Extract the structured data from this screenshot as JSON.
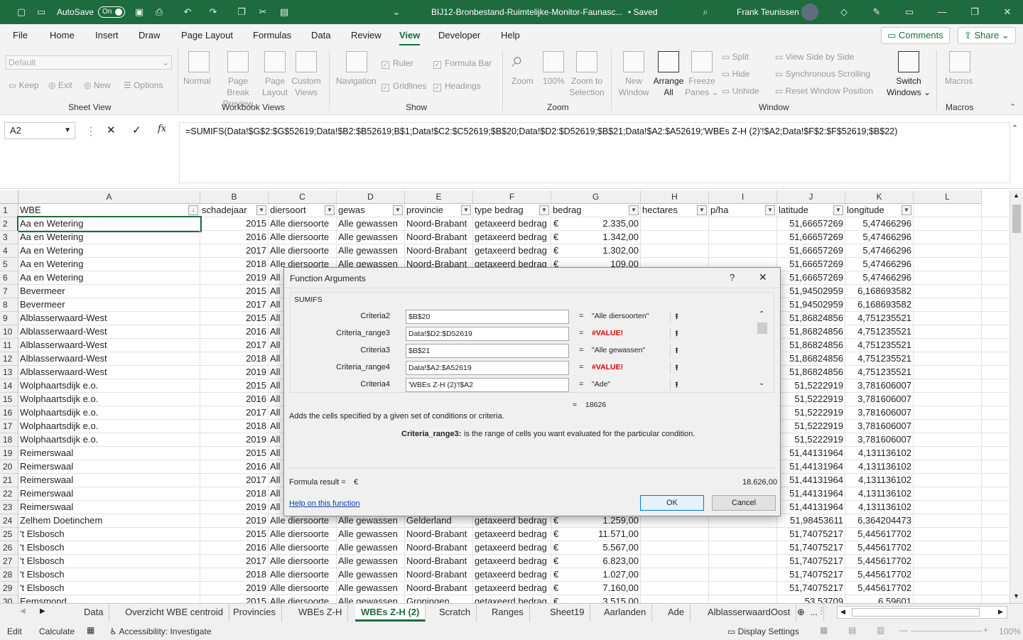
{
  "titlebar": {
    "autosave_label": "AutoSave",
    "autosave_state": "On",
    "filename": "BIJ12-Bronbestand-Ruimtelijke-Monitor-Faunasc...",
    "saved": "• Saved",
    "user": "Frank Teunissen"
  },
  "tabs": [
    "File",
    "Home",
    "Insert",
    "Draw",
    "Page Layout",
    "Formulas",
    "Data",
    "Review",
    "View",
    "Developer",
    "Help"
  ],
  "active_tab": "View",
  "topright": {
    "comments": "Comments",
    "share": "Share"
  },
  "ribbon": {
    "sheetview": {
      "default": "Default",
      "keep": "Keep",
      "exit": "Exit",
      "new": "New",
      "options": "Options",
      "label": "Sheet View"
    },
    "workbookviews": {
      "normal": "Normal",
      "pagebreak1": "Page Break",
      "pagebreak2": "Preview",
      "pagelayout1": "Page",
      "pagelayout2": "Layout",
      "custom1": "Custom",
      "custom2": "Views",
      "label": "Workbook Views"
    },
    "show": {
      "navigation": "Navigation",
      "ruler": "Ruler",
      "formulabar": "Formula Bar",
      "gridlines": "Gridlines",
      "headings": "Headings",
      "label": "Show"
    },
    "zoom": {
      "zoom": "Zoom",
      "hundred": "100%",
      "zts1": "Zoom to",
      "zts2": "Selection",
      "label": "Zoom"
    },
    "window": {
      "new1": "New",
      "new2": "Window",
      "arrange1": "Arrange",
      "arrange2": "All",
      "freeze1": "Freeze",
      "freeze2": "Panes",
      "split": "Split",
      "hide": "Hide",
      "unhide": "Unhide",
      "sbs": "View Side by Side",
      "sync": "Synchronous Scrolling",
      "reset": "Reset Window Position",
      "switch1": "Switch",
      "switch2": "Windows",
      "label": "Window"
    },
    "macros": {
      "macros": "Macros",
      "label": "Macros"
    }
  },
  "namebox": "A2",
  "formula": "=SUMIFS(Data!$G$2:$G$52619;Data!$B2:$B52619;B$1;Data!$C2:$C52619;$B$20;Data!$D2:$D52619;$B$21;Data!$A2:$A52619;'WBEs Z-H (2)'!$A2;Data!$F$2:$F$52619;$B$22)",
  "columns": [
    "A",
    "B",
    "C",
    "D",
    "E",
    "F",
    "G",
    "H",
    "I",
    "J",
    "K",
    "L"
  ],
  "headers": [
    "WBE",
    "schadejaar",
    "diersoort",
    "gewas",
    "provincie",
    "type bedrag",
    "bedrag",
    "hectares",
    "p/ha",
    "latitude",
    "longitude"
  ],
  "rows": [
    {
      "n": "2",
      "a": "Aa en Wetering",
      "b": "2015",
      "c": "Alle diersoorte",
      "d": "Alle gewassen",
      "e": "Noord-Brabant",
      "f": "getaxeerd bedrag",
      "g": "2.335,00",
      "j": "51,66657269",
      "k": "5,47466296"
    },
    {
      "n": "3",
      "a": "Aa en Wetering",
      "b": "2016",
      "c": "Alle diersoorte",
      "d": "Alle gewassen",
      "e": "Noord-Brabant",
      "f": "getaxeerd bedrag",
      "g": "1.342,00",
      "j": "51,66657269",
      "k": "5,47466296"
    },
    {
      "n": "4",
      "a": "Aa en Wetering",
      "b": "2017",
      "c": "Alle diersoorte",
      "d": "Alle gewassen",
      "e": "Noord-Brabant",
      "f": "getaxeerd bedrag",
      "g": "1.302,00",
      "j": "51,66657269",
      "k": "5,47466296"
    },
    {
      "n": "5",
      "a": "Aa en Wetering",
      "b": "2018",
      "c": "Alle diersoorte",
      "d": "Alle gewassen",
      "e": "Noord-Brabant",
      "f": "getaxeerd bedrag",
      "g": "109,00",
      "j": "51,66657269",
      "k": "5,47466296"
    },
    {
      "n": "6",
      "a": "Aa en Wetering",
      "b": "2019",
      "c": "All",
      "d": "",
      "e": "",
      "f": "",
      "g": "",
      "j": "51,66657269",
      "k": "5,47466296"
    },
    {
      "n": "7",
      "a": "Bevermeer",
      "b": "2015",
      "c": "All",
      "d": "",
      "e": "",
      "f": "",
      "g": "",
      "j": "51,94502959",
      "k": "6,168693582"
    },
    {
      "n": "8",
      "a": "Bevermeer",
      "b": "2017",
      "c": "All",
      "d": "",
      "e": "",
      "f": "",
      "g": "",
      "j": "51,94502959",
      "k": "6,168693582"
    },
    {
      "n": "9",
      "a": "Alblasserwaard-West",
      "b": "2015",
      "c": "All",
      "d": "",
      "e": "",
      "f": "",
      "g": "",
      "j": "51,86824856",
      "k": "4,751235521"
    },
    {
      "n": "10",
      "a": "Alblasserwaard-West",
      "b": "2016",
      "c": "All",
      "d": "",
      "e": "",
      "f": "",
      "g": "",
      "j": "51,86824856",
      "k": "4,751235521"
    },
    {
      "n": "11",
      "a": "Alblasserwaard-West",
      "b": "2017",
      "c": "All",
      "d": "",
      "e": "",
      "f": "",
      "g": "",
      "j": "51,86824856",
      "k": "4,751235521"
    },
    {
      "n": "12",
      "a": "Alblasserwaard-West",
      "b": "2018",
      "c": "All",
      "d": "",
      "e": "",
      "f": "",
      "g": "",
      "j": "51,86824856",
      "k": "4,751235521"
    },
    {
      "n": "13",
      "a": "Alblasserwaard-West",
      "b": "2019",
      "c": "All",
      "d": "",
      "e": "",
      "f": "",
      "g": "",
      "j": "51,86824856",
      "k": "4,751235521"
    },
    {
      "n": "14",
      "a": "Wolphaartsdijk e.o.",
      "b": "2015",
      "c": "All",
      "d": "",
      "e": "",
      "f": "",
      "g": "",
      "j": "51,5222919",
      "k": "3,781606007"
    },
    {
      "n": "15",
      "a": "Wolphaartsdijk e.o.",
      "b": "2016",
      "c": "All",
      "d": "",
      "e": "",
      "f": "",
      "g": "",
      "j": "51,5222919",
      "k": "3,781606007"
    },
    {
      "n": "16",
      "a": "Wolphaartsdijk e.o.",
      "b": "2017",
      "c": "All",
      "d": "",
      "e": "",
      "f": "",
      "g": "",
      "j": "51,5222919",
      "k": "3,781606007"
    },
    {
      "n": "17",
      "a": "Wolphaartsdijk e.o.",
      "b": "2018",
      "c": "All",
      "d": "",
      "e": "",
      "f": "",
      "g": "",
      "j": "51,5222919",
      "k": "3,781606007"
    },
    {
      "n": "18",
      "a": "Wolphaartsdijk e.o.",
      "b": "2019",
      "c": "All",
      "d": "",
      "e": "",
      "f": "",
      "g": "",
      "j": "51,5222919",
      "k": "3,781606007"
    },
    {
      "n": "19",
      "a": "Reimerswaal",
      "b": "2015",
      "c": "All",
      "d": "",
      "e": "",
      "f": "",
      "g": "",
      "j": "51,44131964",
      "k": "4,131136102"
    },
    {
      "n": "20",
      "a": "Reimerswaal",
      "b": "2016",
      "c": "All",
      "d": "",
      "e": "",
      "f": "",
      "g": "",
      "j": "51,44131964",
      "k": "4,131136102"
    },
    {
      "n": "21",
      "a": "Reimerswaal",
      "b": "2017",
      "c": "All",
      "d": "",
      "e": "",
      "f": "",
      "g": "",
      "j": "51,44131964",
      "k": "4,131136102"
    },
    {
      "n": "22",
      "a": "Reimerswaal",
      "b": "2018",
      "c": "All",
      "d": "",
      "e": "",
      "f": "",
      "g": "",
      "j": "51,44131964",
      "k": "4,131136102"
    },
    {
      "n": "23",
      "a": "Reimerswaal",
      "b": "2019",
      "c": "All",
      "d": "",
      "e": "",
      "f": "",
      "g": "",
      "j": "51,44131964",
      "k": "4,131136102"
    },
    {
      "n": "24",
      "a": "Zelhem Doetinchem",
      "b": "2019",
      "c": "Alle diersoorte",
      "d": "Alle gewassen",
      "e": "Gelderland",
      "f": "getaxeerd bedrag",
      "g": "1.259,00",
      "j": "51,98453611",
      "k": "6,364204473"
    },
    {
      "n": "25",
      "a": "'t Elsbosch",
      "b": "2015",
      "c": "Alle diersoorte",
      "d": "Alle gewassen",
      "e": "Noord-Brabant",
      "f": "getaxeerd bedrag",
      "g": "11.571,00",
      "j": "51,74075217",
      "k": "5,445617702"
    },
    {
      "n": "26",
      "a": "'t Elsbosch",
      "b": "2016",
      "c": "Alle diersoorte",
      "d": "Alle gewassen",
      "e": "Noord-Brabant",
      "f": "getaxeerd bedrag",
      "g": "5.567,00",
      "j": "51,74075217",
      "k": "5,445617702"
    },
    {
      "n": "27",
      "a": "'t Elsbosch",
      "b": "2017",
      "c": "Alle diersoorte",
      "d": "Alle gewassen",
      "e": "Noord-Brabant",
      "f": "getaxeerd bedrag",
      "g": "6.823,00",
      "j": "51,74075217",
      "k": "5,445617702"
    },
    {
      "n": "28",
      "a": "'t Elsbosch",
      "b": "2018",
      "c": "Alle diersoorte",
      "d": "Alle gewassen",
      "e": "Noord-Brabant",
      "f": "getaxeerd bedrag",
      "g": "1.027,00",
      "j": "51,74075217",
      "k": "5,445617702"
    },
    {
      "n": "29",
      "a": "'t Elsbosch",
      "b": "2019",
      "c": "Alle diersoorte",
      "d": "Alle gewassen",
      "e": "Noord-Brabant",
      "f": "getaxeerd bedrag",
      "g": "7.160,00",
      "j": "51,74075217",
      "k": "5,445617702"
    },
    {
      "n": "30",
      "a": "Eemsmond",
      "b": "2015",
      "c": "Alle diersoorte",
      "d": "Alle gewassen",
      "e": "Groningen",
      "f": "getaxeerd bedrag",
      "g": "3.515,00",
      "j": "53,53709",
      "k": "6,59601"
    }
  ],
  "currency": "€",
  "sheets": [
    "Data",
    "Overzicht WBE centroid",
    "Provincies",
    "WBEs Z-H",
    "WBEs Z-H (2)",
    "Scratch",
    "Ranges",
    "Sheet19",
    "Aarlanden",
    "Ade",
    "AlblasserwaardOost",
    "..."
  ],
  "active_sheet": "WBEs Z-H (2)",
  "status": {
    "mode": "Edit",
    "calculate": "Calculate",
    "accessibility": "Accessibility: Investigate",
    "display": "Display Settings",
    "zoom": "100%"
  },
  "dialog": {
    "title": "Function Arguments",
    "help_q": "?",
    "close": "✕",
    "function": "SUMIFS",
    "args": [
      {
        "label": "Criteria2",
        "value": "$B$20",
        "result": "\"Alle diersoorten\"",
        "err": false
      },
      {
        "label": "Criteria_range3",
        "value": "Data!$D2:$D52619",
        "result": "#VALUE!",
        "err": true
      },
      {
        "label": "Criteria3",
        "value": "$B$21",
        "result": "\"Alle gewassen\"",
        "err": false
      },
      {
        "label": "Criteria_range4",
        "value": "Data!$A2:$A52619",
        "result": "#VALUE!",
        "err": true
      },
      {
        "label": "Criteria4",
        "value": "'WBEs Z-H (2)'!$A2",
        "result": "\"Ade\"",
        "err": false
      }
    ],
    "total_eq": "=",
    "total": "18626",
    "description": "Adds the cells specified by a given set of conditions or criteria.",
    "arg_name": "Criteria_range3:",
    "arg_desc": "is the range of cells you want evaluated for the particular condition.",
    "result_label": "Formula result =",
    "result_currency": "€",
    "result_value": "18.626,00",
    "help_link": "Help on this function",
    "ok": "OK",
    "cancel": "Cancel"
  }
}
